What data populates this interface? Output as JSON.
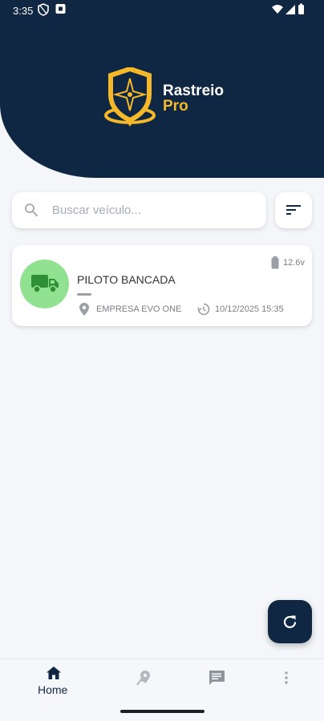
{
  "status_bar": {
    "time": "3:35"
  },
  "brand": {
    "name_line1": "Rastreio",
    "name_line2": "Pro",
    "primary_color": "#0f2742",
    "accent_color": "#f5b82a"
  },
  "search": {
    "placeholder": "Buscar veículo..."
  },
  "vehicles": [
    {
      "name": "PILOTO BANCADA",
      "voltage": "12.6v",
      "company": "EMPRESA EVO ONE",
      "last_update": "10/12/2025 15:35",
      "status_color": "#90e291"
    }
  ],
  "bottom_nav": {
    "home_label": "Home",
    "items": [
      "home-icon",
      "map-pin-icon",
      "chat-icon",
      "more-vert-icon"
    ]
  }
}
